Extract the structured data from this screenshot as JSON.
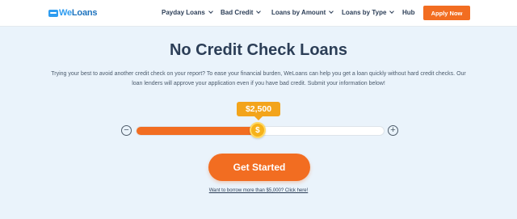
{
  "brand": {
    "logo_text_pre": "We",
    "logo_text_post": "Loans",
    "accent": "#2e9cf0"
  },
  "nav": {
    "items": [
      {
        "label": "Payday Loans",
        "has_dropdown": true
      },
      {
        "label": "Bad Credit",
        "has_dropdown": true
      },
      {
        "label": "Loans by Amount",
        "has_dropdown": true
      },
      {
        "label": "Loans by Type",
        "has_dropdown": true
      },
      {
        "label": "Hub",
        "has_dropdown": false
      }
    ],
    "apply_label": "Apply Now",
    "apply_color": "#f26d21"
  },
  "hero": {
    "title": "No Credit Check Loans",
    "description_line1": "Trying your best to avoid another credit check on your report? To ease your financial burden, WeLoans can help you get a loan quickly without hard credit checks. Our",
    "description_line2": "loan lenders will approve your application even if you have bad credit. Submit your information below!"
  },
  "slider": {
    "amount_label": "$2,500",
    "value": 2500,
    "min": 100,
    "max": 5000,
    "thumb_symbol": "$",
    "decrease_symbol": "−",
    "increase_symbol": "+"
  },
  "cta": {
    "label": "Get Started",
    "link_text": "Want to borrow more than $5,000? Click here!"
  },
  "icons": [
    "chevron-down-icon",
    "minus-icon",
    "plus-icon",
    "dollar-coin-icon"
  ]
}
